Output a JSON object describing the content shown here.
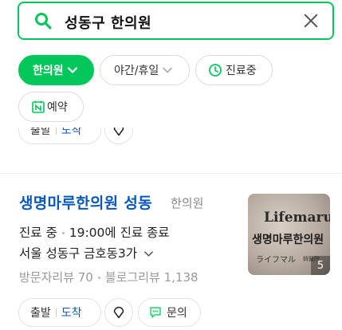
{
  "search": {
    "query": "성동구 한의원"
  },
  "filters": [
    {
      "label": "한의원",
      "active": true
    },
    {
      "label": "야간/휴일",
      "active": false
    },
    {
      "label": "진료중",
      "active": false
    },
    {
      "label": "예약",
      "active": false
    }
  ],
  "top_actions": {
    "depart": "출발",
    "arrive": "도착"
  },
  "result": {
    "name": "생명마루한의원 성동",
    "category": "한의원",
    "status": "진료 중",
    "hours": "19:00에 진료 종료",
    "address": "서울 성동구 금호동3가",
    "visitor_reviews": "방문자리뷰 70",
    "blog_reviews": "블로그리뷰 1,138",
    "photo": {
      "title": "Lifemaru",
      "korean": "생명마루한의원",
      "japanese": "ライフマル",
      "hanja": "韓醫院",
      "count": "5"
    },
    "actions": {
      "depart": "출발",
      "arrive": "도착",
      "inquiry": "문의"
    }
  },
  "colors": {
    "accent": "#03c75a",
    "link": "#0a57bd"
  }
}
